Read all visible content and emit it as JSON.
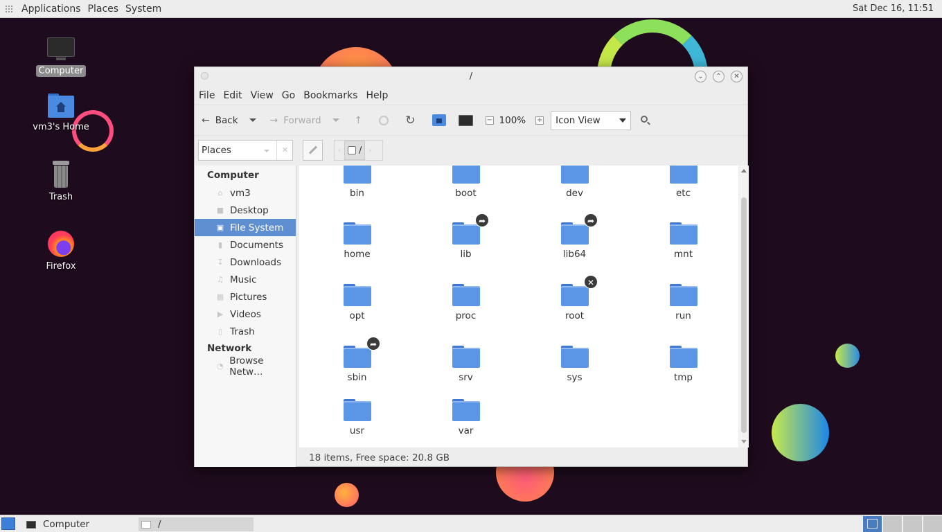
{
  "top_panel": {
    "menus": [
      "Applications",
      "Places",
      "System"
    ],
    "clock": "Sat Dec 16, 11:51"
  },
  "desktop": {
    "icons": [
      {
        "label": "Computer",
        "icon": "computer-monitor-icon",
        "selected": true
      },
      {
        "label": "vm3's Home",
        "icon": "home-folder-icon",
        "selected": false
      },
      {
        "label": "Trash",
        "icon": "trash-bin-icon",
        "selected": false
      },
      {
        "label": "Firefox",
        "icon": "firefox-icon",
        "selected": false
      }
    ]
  },
  "window": {
    "title": "/",
    "menu": [
      "File",
      "Edit",
      "View",
      "Go",
      "Bookmarks",
      "Help"
    ],
    "toolbar": {
      "back_label": "Back",
      "forward_label": "Forward",
      "zoom_level": "100%",
      "view_mode": "Icon View"
    },
    "location": {
      "places_label": "Places",
      "path_current": "/"
    },
    "sidebar": {
      "sections": [
        {
          "heading": "Computer",
          "items": [
            {
              "label": "vm3",
              "icon": "home-icon",
              "active": false
            },
            {
              "label": "Desktop",
              "icon": "desktop-icon",
              "active": false
            },
            {
              "label": "File System",
              "icon": "drive-icon",
              "active": true
            },
            {
              "label": "Documents",
              "icon": "documents-icon",
              "active": false
            },
            {
              "label": "Downloads",
              "icon": "downloads-icon",
              "active": false
            },
            {
              "label": "Music",
              "icon": "music-icon",
              "active": false
            },
            {
              "label": "Pictures",
              "icon": "pictures-icon",
              "active": false
            },
            {
              "label": "Videos",
              "icon": "videos-icon",
              "active": false
            },
            {
              "label": "Trash",
              "icon": "trash-icon",
              "active": false
            }
          ]
        },
        {
          "heading": "Network",
          "items": [
            {
              "label": "Browse Netw…",
              "icon": "network-icon",
              "active": false
            }
          ]
        }
      ]
    },
    "files": [
      {
        "name": "bin",
        "emblem": null
      },
      {
        "name": "boot",
        "emblem": null
      },
      {
        "name": "dev",
        "emblem": null
      },
      {
        "name": "etc",
        "emblem": null
      },
      {
        "name": "home",
        "emblem": null
      },
      {
        "name": "lib",
        "emblem": "symlink"
      },
      {
        "name": "lib64",
        "emblem": "symlink"
      },
      {
        "name": "mnt",
        "emblem": null
      },
      {
        "name": "opt",
        "emblem": null
      },
      {
        "name": "proc",
        "emblem": null
      },
      {
        "name": "root",
        "emblem": "no-access"
      },
      {
        "name": "run",
        "emblem": null
      },
      {
        "name": "sbin",
        "emblem": "symlink"
      },
      {
        "name": "srv",
        "emblem": null
      },
      {
        "name": "sys",
        "emblem": null
      },
      {
        "name": "tmp",
        "emblem": null
      },
      {
        "name": "usr",
        "emblem": null
      },
      {
        "name": "var",
        "emblem": null
      }
    ],
    "status": "18 items, Free space: 20.8 GB"
  },
  "taskbar": {
    "tasks": [
      {
        "label": "Computer",
        "icon": "computer-icon"
      },
      {
        "label": "/",
        "icon": "folder-icon"
      }
    ]
  },
  "colors": {
    "desktop_bg": "#1e0b1d",
    "selection": "#5f8ed1",
    "folder": "#5b96e6"
  }
}
